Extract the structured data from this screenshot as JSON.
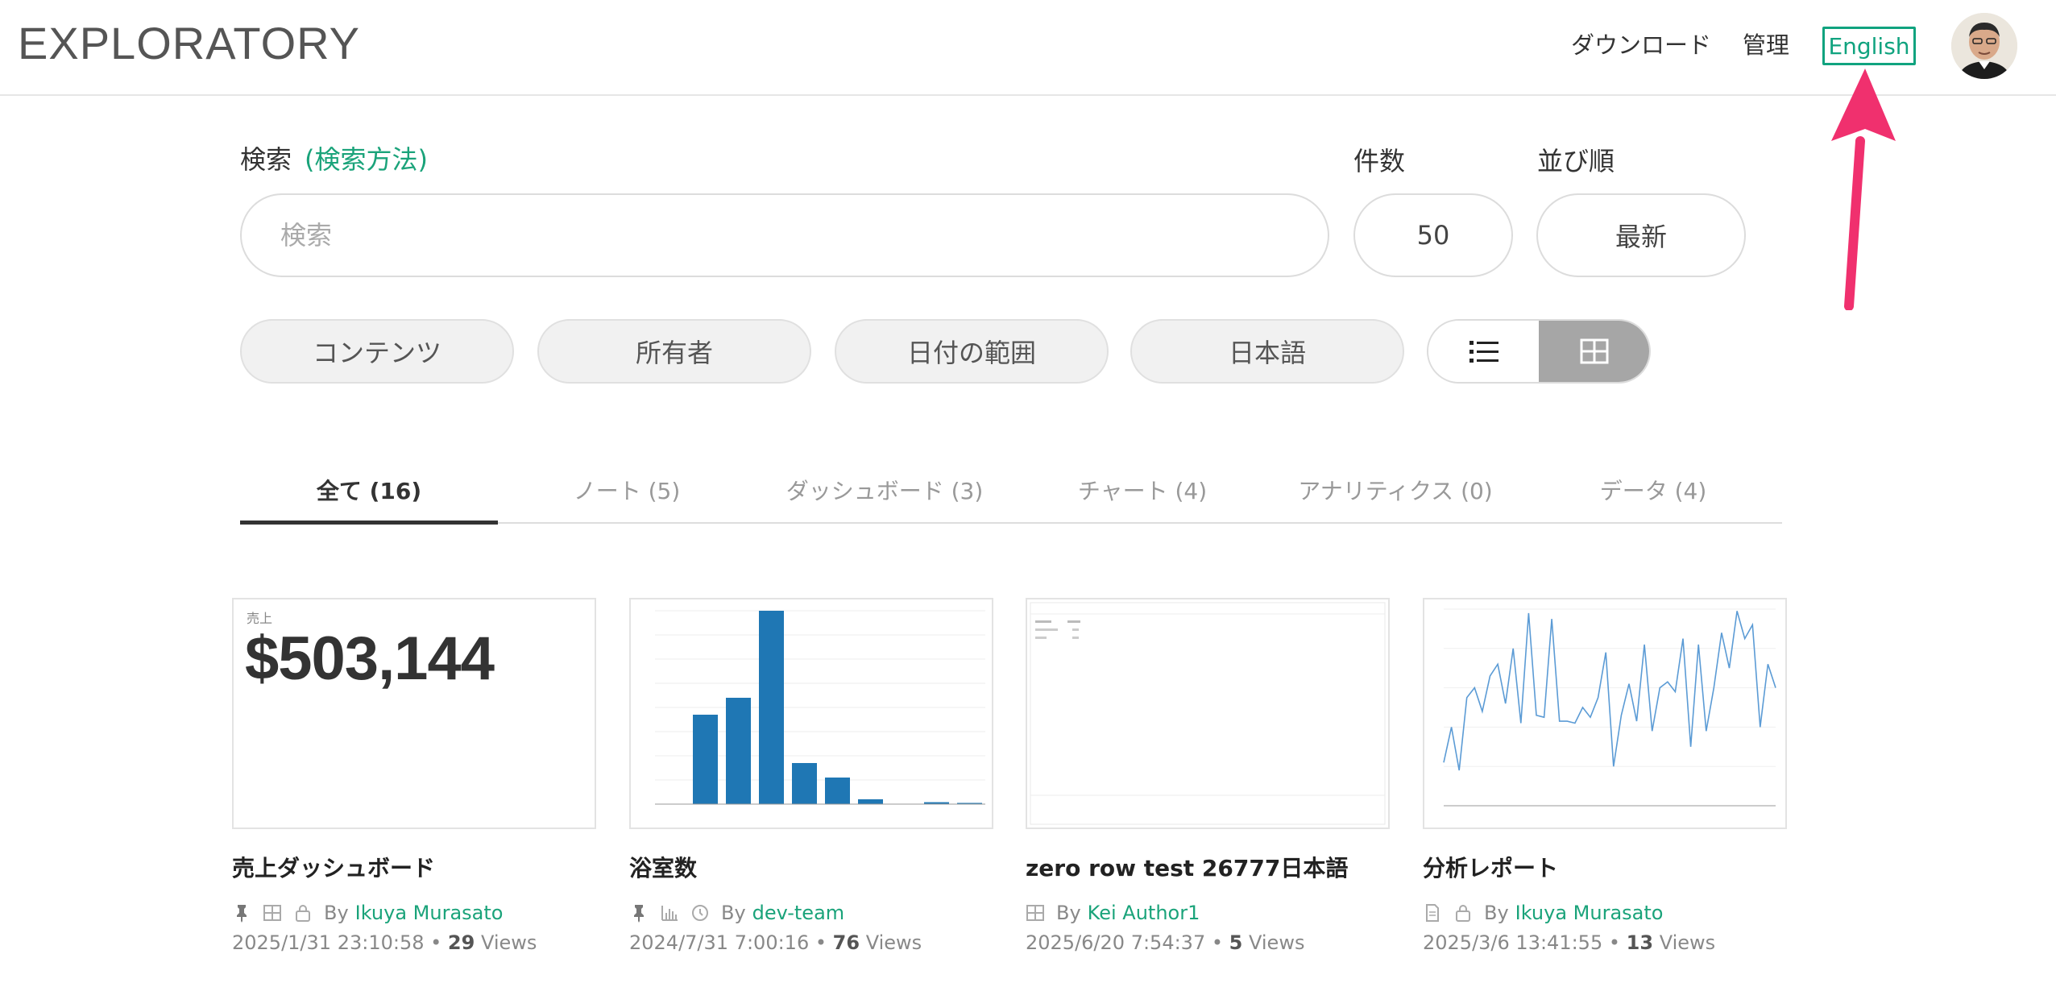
{
  "header": {
    "logo": "EXPLORATORY",
    "nav": {
      "download": "ダウンロード",
      "admin": "管理",
      "language": "English"
    }
  },
  "search": {
    "label": "検索",
    "help_link": "(検索方法)",
    "placeholder": "検索",
    "count_label": "件数",
    "count_value": "50",
    "sort_label": "並び順",
    "sort_value": "最新"
  },
  "filters": {
    "content": "コンテンツ",
    "owner": "所有者",
    "date_range": "日付の範囲",
    "language": "日本語",
    "view_mode": "grid"
  },
  "tabs": [
    {
      "label": "全て (16)",
      "active": true
    },
    {
      "label": "ノート (5)",
      "active": false
    },
    {
      "label": "ダッシュボード (3)",
      "active": false
    },
    {
      "label": "チャート (4)",
      "active": false
    },
    {
      "label": "アナリティクス (0)",
      "active": false
    },
    {
      "label": "データ (4)",
      "active": false
    }
  ],
  "cards": [
    {
      "title": "売上ダッシュボード",
      "thumb_kpi_label": "売上",
      "thumb_kpi_value": "$503,144",
      "icons": [
        "pin-icon",
        "grid-icon",
        "lock-icon"
      ],
      "by": "By",
      "author": "Ikuya Murasato",
      "date": "2025/1/31 23:10:58",
      "views_count": "29",
      "views_label": "Views"
    },
    {
      "title": "浴室数",
      "icons": [
        "pin-icon",
        "bar-chart-icon",
        "clock-icon"
      ],
      "by": "By",
      "author": "dev-team",
      "date": "2024/7/31 7:00:16",
      "views_count": "76",
      "views_label": "Views",
      "thumb_bars": [
        0,
        370,
        440,
        800,
        170,
        110,
        20,
        0,
        8,
        5
      ]
    },
    {
      "title": "zero row test 26777日本語",
      "icons": [
        "grid-icon"
      ],
      "by": "By",
      "author": "Kei Author1",
      "date": "2025/6/20 7:54:37",
      "views_count": "5",
      "views_label": "Views"
    },
    {
      "title": "分析レポート",
      "icons": [
        "document-icon",
        "lock-icon"
      ],
      "by": "By",
      "author": "Ikuya Murasato",
      "date": "2025/3/6 13:41:55",
      "views_count": "13",
      "views_label": "Views",
      "thumb_line": [
        22,
        40,
        18,
        55,
        60,
        48,
        66,
        72,
        52,
        80,
        42,
        98,
        46,
        45,
        95,
        43,
        43,
        42,
        50,
        45,
        55,
        78,
        20,
        46,
        62,
        43,
        82,
        38,
        60,
        63,
        58,
        85,
        30,
        82,
        38,
        60,
        88,
        70,
        99,
        85,
        92,
        40,
        72,
        60
      ]
    }
  ],
  "colors": {
    "accent": "#1aa37a",
    "arrow": "#f0306e",
    "bar": "#1f77b4"
  }
}
